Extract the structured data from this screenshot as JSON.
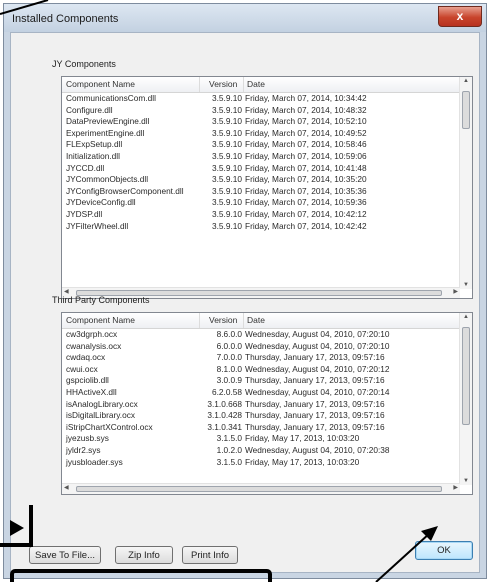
{
  "window": {
    "title": "Installed Components",
    "close_label": "x"
  },
  "jy": {
    "label": "JY Components",
    "headers": {
      "name": "Component Name",
      "version": "Version",
      "date": "Date"
    },
    "rows": [
      {
        "name": "CommunicationsCom.dll",
        "version": "3.5.9.10",
        "date": "Friday, March 07, 2014,  10:34:42"
      },
      {
        "name": "Configure.dll",
        "version": "3.5.9.10",
        "date": "Friday, March 07, 2014,  10:48:32"
      },
      {
        "name": "DataPreviewEngine.dll",
        "version": "3.5.9.10",
        "date": "Friday, March 07, 2014,  10:52:10"
      },
      {
        "name": "ExperimentEngine.dll",
        "version": "3.5.9.10",
        "date": "Friday, March 07, 2014,  10:49:52"
      },
      {
        "name": "FLExpSetup.dll",
        "version": "3.5.9.10",
        "date": "Friday, March 07, 2014,  10:58:46"
      },
      {
        "name": "Initialization.dll",
        "version": "3.5.9.10",
        "date": "Friday, March 07, 2014,  10:59:06"
      },
      {
        "name": "JYCCD.dll",
        "version": "3.5.9.10",
        "date": "Friday, March 07, 2014,  10:41:48"
      },
      {
        "name": "JYCommonObjects.dll",
        "version": "3.5.9.10",
        "date": "Friday, March 07, 2014,  10:35:20"
      },
      {
        "name": "JYConfigBrowserComponent.dll",
        "version": "3.5.9.10",
        "date": "Friday, March 07, 2014,  10:35:36"
      },
      {
        "name": "JYDeviceConfig.dll",
        "version": "3.5.9.10",
        "date": "Friday, March 07, 2014,  10:59:36"
      },
      {
        "name": "JYDSP.dll",
        "version": "3.5.9.10",
        "date": "Friday, March 07, 2014,  10:42:12"
      },
      {
        "name": "JYFilterWheel.dll",
        "version": "3.5.9.10",
        "date": "Friday, March 07, 2014,  10:42:42"
      }
    ]
  },
  "third": {
    "label": "Third Party Components",
    "headers": {
      "name": "Component Name",
      "version": "Version",
      "date": "Date"
    },
    "rows": [
      {
        "name": "cw3dgrph.ocx",
        "version": "8.6.0.0",
        "date": "Wednesday, August 04, 2010,  07:20:10"
      },
      {
        "name": "cwanalysis.ocx",
        "version": "6.0.0.0",
        "date": "Wednesday, August 04, 2010,  07:20:10"
      },
      {
        "name": "cwdaq.ocx",
        "version": "7.0.0.0",
        "date": "Thursday, January 17, 2013,  09:57:16"
      },
      {
        "name": "cwui.ocx",
        "version": "8.1.0.0",
        "date": "Wednesday, August 04, 2010,  07:20:12"
      },
      {
        "name": "gspciolib.dll",
        "version": "3.0.0.9",
        "date": "Thursday, January 17, 2013,  09:57:16"
      },
      {
        "name": "HHActiveX.dll",
        "version": "6.2.0.58",
        "date": "Wednesday, August 04, 2010,  07:20:14"
      },
      {
        "name": "isAnalogLibrary.ocx",
        "version": "3.1.0.668",
        "date": "Thursday, January 17, 2013,  09:57:16"
      },
      {
        "name": "isDigitalLibrary.ocx",
        "version": "3.1.0.428",
        "date": "Thursday, January 17, 2013,  09:57:16"
      },
      {
        "name": "iStripChartXControl.ocx",
        "version": "3.1.0.341",
        "date": "Thursday, January 17, 2013,  09:57:16"
      },
      {
        "name": "jyezusb.sys",
        "version": "3.1.5.0",
        "date": "Friday, May 17, 2013,  10:03:20"
      },
      {
        "name": "jyldr2.sys",
        "version": "1.0.2.0",
        "date": "Wednesday, August 04, 2010,  07:20:38"
      },
      {
        "name": "jyusbloader.sys",
        "version": "3.1.5.0",
        "date": "Friday, May 17, 2013,  10:03:20"
      }
    ]
  },
  "buttons": {
    "save": "Save To File...",
    "zip": "Zip Info",
    "print": "Print Info",
    "ok": "OK"
  },
  "colors": {
    "annotation": "#000000",
    "titlebar": "#c9d5e3",
    "close": "#c8442c",
    "ok_border": "#3c7fb1"
  }
}
